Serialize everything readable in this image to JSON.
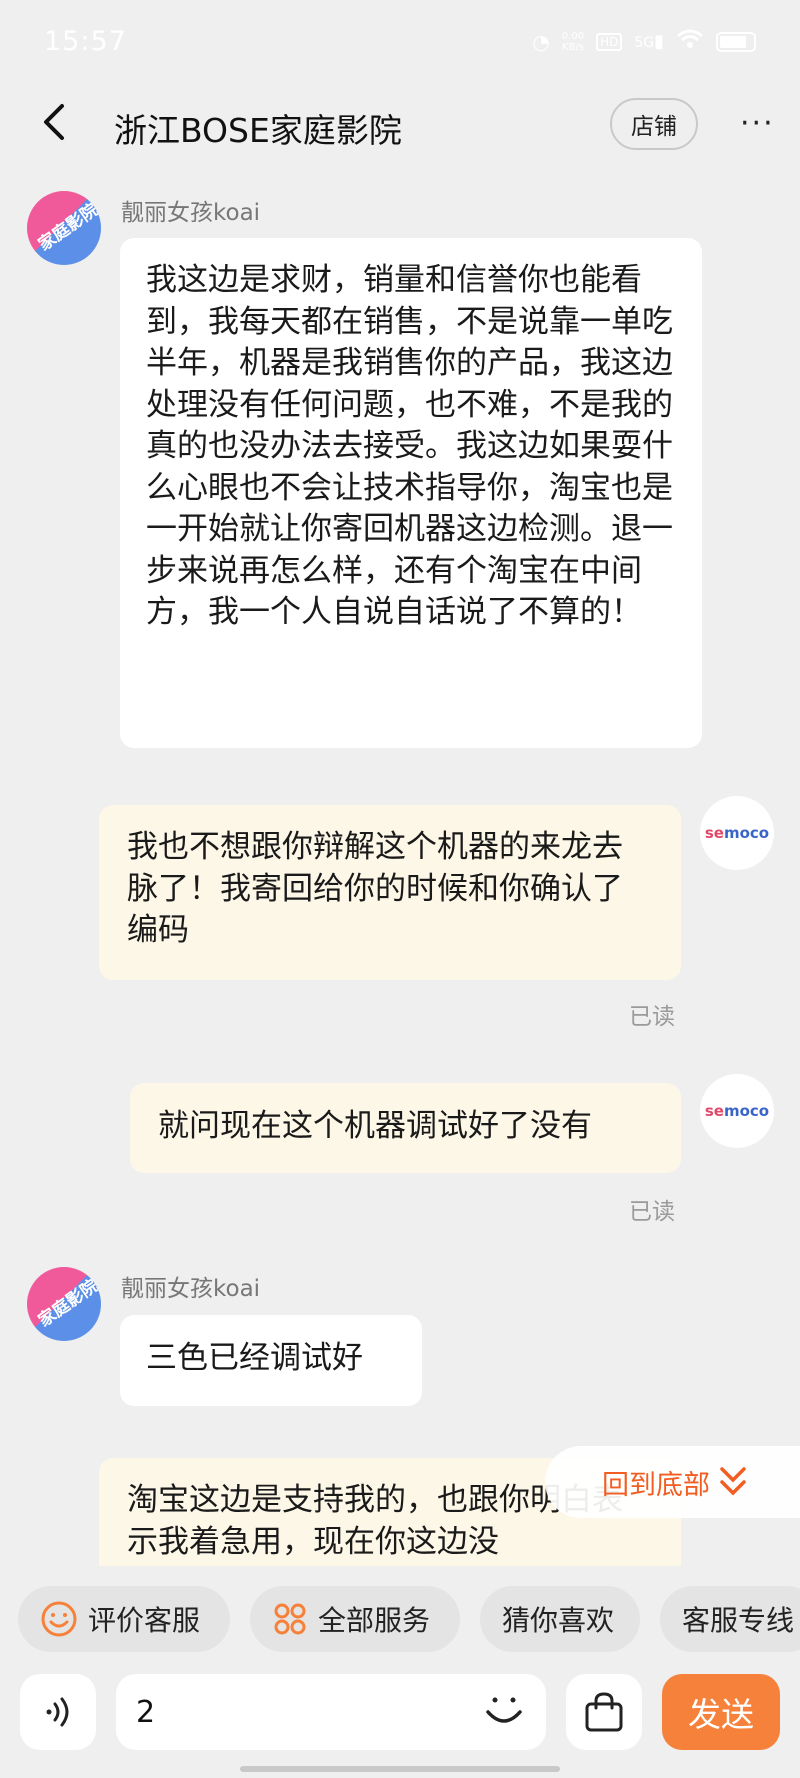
{
  "status_bar": {
    "time": "15:57",
    "net_speed": "0.00\nKB/s",
    "hd": "HD",
    "signal": "5G"
  },
  "header": {
    "back_icon": "chevron-left-icon",
    "title": "浙江BOSE家庭影院",
    "shop_label": "店铺",
    "more_label": "···"
  },
  "messages": [
    {
      "side": "left",
      "sender": "靓丽女孩koai",
      "avatar_text": "家庭影院",
      "text": "我这边是求财，销量和信誉你也能看到，我每天都在销售，不是说靠一单吃半年，机器是我销售你的产品，我这边处理没有任何问题，也不难，不是我的真的也没办法去接受。我这边如果耍什么心眼也不会让技术指导你，淘宝也是一开始就让你寄回机器这边检测。退一步来说再怎么样，还有个淘宝在中间方，我一个人自说自话说了不算的！"
    },
    {
      "side": "right",
      "avatar_text": "semoco",
      "text": "我也不想跟你辩解这个机器的来龙去脉了！我寄回给你的时候和你确认了编码",
      "status": "已读"
    },
    {
      "side": "right",
      "avatar_text": "semoco",
      "text": "就问现在这个机器调试好了没有",
      "status": "已读"
    },
    {
      "side": "left",
      "sender": "靓丽女孩koai",
      "avatar_text": "家庭影院",
      "text": "三色已经调试好"
    },
    {
      "side": "right",
      "text": "淘宝这边是支持我的，也跟你明白表示我着急用，现在你这边没"
    }
  ],
  "scroll_to_bottom": "回到底部",
  "quick_services": [
    {
      "label": "评价客服",
      "icon": "smile-icon"
    },
    {
      "label": "全部服务",
      "icon": "grid-icon"
    },
    {
      "label": "猜你喜欢",
      "icon": ""
    },
    {
      "label": "客服专线",
      "icon": ""
    }
  ],
  "input": {
    "value": "2",
    "send_label": "发送"
  },
  "colors": {
    "accent": "#f5813a",
    "fab_text": "#f25d22",
    "right_bubble": "#fdf7e8",
    "background": "#efefef"
  }
}
